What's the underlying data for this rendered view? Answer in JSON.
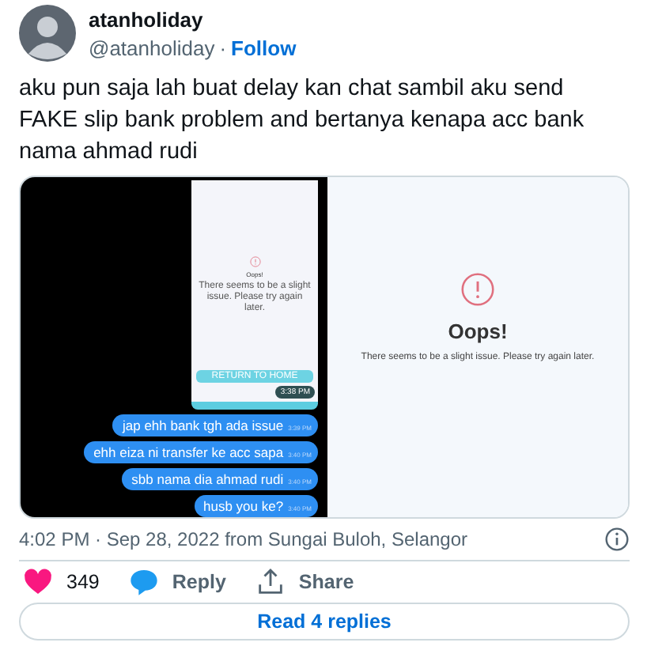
{
  "author": {
    "name": "atanholiday",
    "handle": "@atanholiday",
    "separator": "·",
    "follow": "Follow"
  },
  "text": "aku pun saja lah buat delay kan chat sambil aku send FAKE slip bank problem and bertanya kenapa acc bank nama ahmad rudi",
  "media": {
    "phone": {
      "title": "Oops!",
      "message": "There seems to be a slight issue. Please try again later.",
      "button": "RETURN TO HOME",
      "time": "3:38 PM"
    },
    "messages": [
      {
        "text": "jap ehh bank tgh ada issue",
        "time": "3:39 PM"
      },
      {
        "text": "ehh eiza ni transfer ke acc sapa",
        "time": "3:40 PM"
      },
      {
        "text": "sbb nama dia ahmad rudi",
        "time": "3:40 PM"
      },
      {
        "text": "husb you ke?",
        "time": "3:40 PM"
      }
    ],
    "error": {
      "title": "Oops!",
      "message": "There seems to be a slight issue. Please try again later."
    }
  },
  "meta": {
    "time": "4:02 PM · Sep 28, 2022 from Sungai Buloh, Selangor"
  },
  "actions": [
    {
      "kind": "like",
      "label": "349"
    },
    {
      "kind": "reply",
      "label": "Reply"
    },
    {
      "kind": "share",
      "label": "Share"
    }
  ],
  "replies_button": "Read 4 replies"
}
